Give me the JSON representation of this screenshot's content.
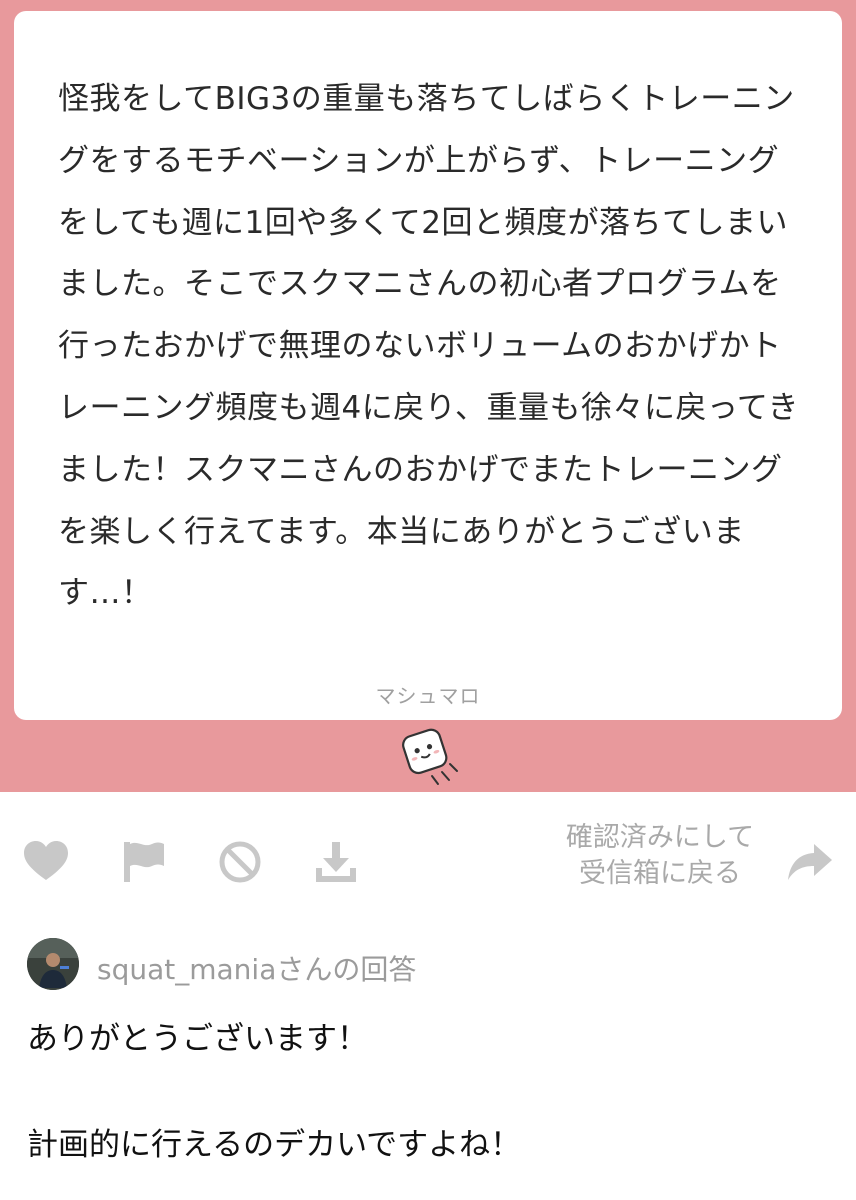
{
  "question": {
    "text": "怪我をしてBIG3の重量も落ちてしばらくトレーニングをするモチベーションが上がらず、トレーニングをしても週に1回や多くて2回と頻度が落ちてしまいました。そこでスクマニさんの初心者プログラムを行ったおかげで無理のないボリュームのおかげかトレーニング頻度も週4に戻り、重量も徐々に戻ってきました！スクマニさんのおかげでまたトレーニングを楽しく行えてます。本当にありがとうございます…！",
    "brand": "マシュマロ"
  },
  "colors": {
    "band": "#e8999c",
    "icon": "#c8c8c8",
    "muted_text": "#a9a9a9"
  },
  "actions": {
    "icons": [
      "heart-icon",
      "flag-icon",
      "block-icon",
      "download-icon",
      "forward-icon"
    ],
    "confirm_line1": "確認済みにして",
    "confirm_line2": "受信箱に戻る"
  },
  "answer": {
    "label": "squat_maniaさんの回答",
    "line1": "ありがとうございます！",
    "line2": "計画的に行えるのデカいですよね！"
  }
}
